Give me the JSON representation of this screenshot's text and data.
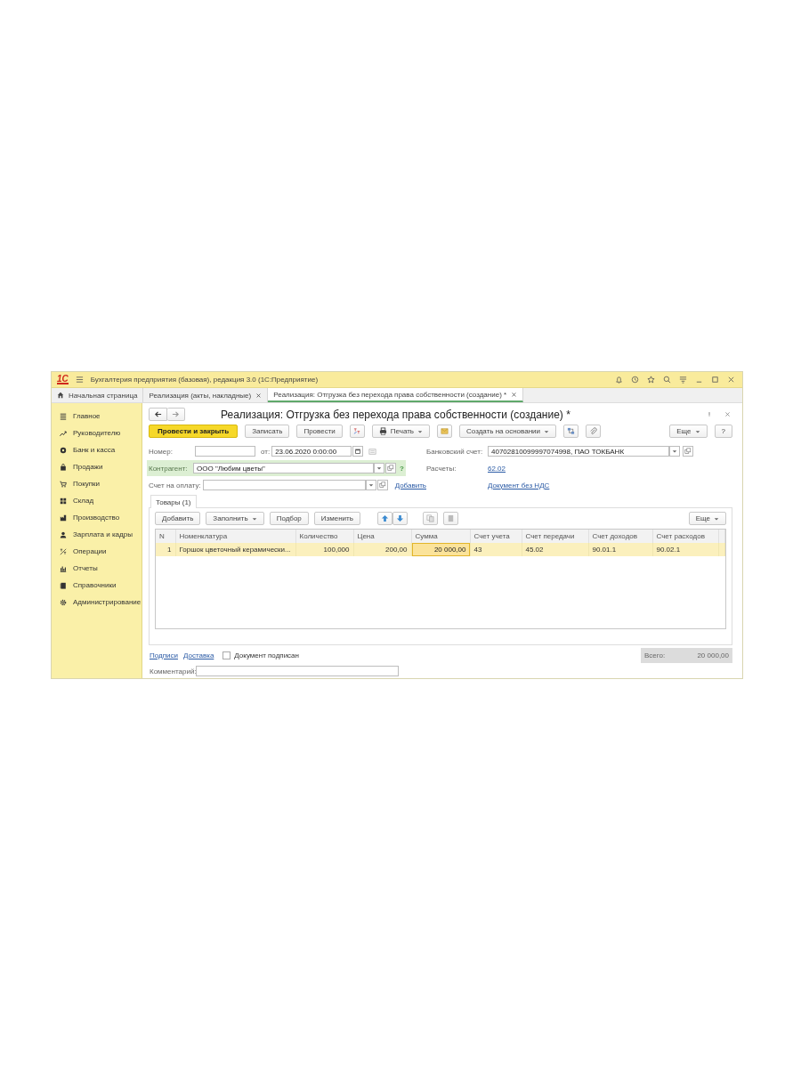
{
  "title_bar": {
    "logo": "1С",
    "title": "Бухгалтерия предприятия (базовая), редакция 3.0  (1С:Предприятие)"
  },
  "tabs": [
    {
      "label": "Начальная страница",
      "selected": false,
      "closable": false
    },
    {
      "label": "Реализация (акты, накладные)",
      "selected": false,
      "closable": true
    },
    {
      "label": "Реализация: Отгрузка без перехода права собственности (создание) *",
      "selected": true,
      "closable": true
    }
  ],
  "sidebar": {
    "items": [
      {
        "label": "Главное"
      },
      {
        "label": "Руководителю"
      },
      {
        "label": "Банк и касса"
      },
      {
        "label": "Продажи"
      },
      {
        "label": "Покупки"
      },
      {
        "label": "Склад"
      },
      {
        "label": "Производство"
      },
      {
        "label": "Зарплата и кадры"
      },
      {
        "label": "Операции"
      },
      {
        "label": "Отчеты"
      },
      {
        "label": "Справочники"
      },
      {
        "label": "Администрирование"
      }
    ]
  },
  "form": {
    "title": "Реализация: Отгрузка без перехода права собственности (создание) *",
    "toolbar": [
      {
        "kind": "primary",
        "label": "Провести и закрыть"
      },
      {
        "kind": "plain",
        "label": "Записать"
      },
      {
        "kind": "plain",
        "label": "Провести"
      },
      {
        "kind": "icon"
      },
      {
        "kind": "menu",
        "label": "Печать"
      },
      {
        "kind": "icon"
      },
      {
        "kind": "menu",
        "label": "Создать на основании"
      },
      {
        "kind": "icon"
      },
      {
        "kind": "icon"
      }
    ],
    "toolbar_right": [
      {
        "kind": "menu",
        "label": "Еще"
      },
      {
        "kind": "plain",
        "label": "?"
      }
    ],
    "number": {
      "label": "Номер:"
    },
    "date": {
      "label": "от:",
      "value": "23.06.2020  0:00:00"
    },
    "bank_account": {
      "label": "Банковский счет:",
      "value": "40702810099997074998, ПАО ТОКБАНК"
    },
    "counterparty": {
      "label": "Контрагент:",
      "value": "ООО \"Любим цветы\"",
      "hint": "?"
    },
    "settlements": {
      "label": "Расчеты:",
      "link": "62.02"
    },
    "invoice": {
      "label": "Счет на оплату:",
      "link": "Добавить"
    },
    "vat_link": "Документ без НДС",
    "section_tabs": [
      {
        "label": "Товары (1)",
        "selected": true
      }
    ],
    "table_toolbar": [
      {
        "kind": "plain",
        "label": "Добавить"
      },
      {
        "kind": "menu",
        "label": "Заполнить"
      },
      {
        "kind": "plain",
        "label": "Подбор"
      },
      {
        "kind": "plain",
        "label": "Изменить"
      },
      {
        "kind": "icon"
      },
      {
        "kind": "icon"
      },
      {
        "kind": "icon"
      },
      {
        "kind": "icon"
      }
    ],
    "table_toolbar_right": [
      {
        "kind": "menu",
        "label": "Еще"
      }
    ],
    "table": {
      "columns": [
        {
          "label": "N",
          "kind": "number"
        },
        {
          "label": "Номенклатура",
          "kind": "text"
        },
        {
          "label": "Количество",
          "kind": "number"
        },
        {
          "label": "Цена",
          "kind": "number"
        },
        {
          "label": "Сумма",
          "kind": "number"
        },
        {
          "label": "Счет учета",
          "kind": "text"
        },
        {
          "label": "Счет передачи",
          "kind": "text"
        },
        {
          "label": "Счет доходов",
          "kind": "text"
        },
        {
          "label": "Счет расходов",
          "kind": "text"
        }
      ],
      "rows": [
        {
          "selected": true,
          "cells": [
            {
              "text": "1",
              "focused": false
            },
            {
              "text": "Горшок цветочный керамически...",
              "focused": false
            },
            {
              "text": "100,000",
              "focused": false
            },
            {
              "text": "200,00",
              "focused": false
            },
            {
              "text": "20 000,00",
              "focused": true
            },
            {
              "text": "43",
              "focused": false
            },
            {
              "text": "45.02",
              "focused": false
            },
            {
              "text": "90.01.1",
              "focused": false
            },
            {
              "text": "90.02.1",
              "focused": false
            }
          ]
        }
      ]
    },
    "footer": {
      "links": [
        "Подписи",
        "Доставка"
      ],
      "signed": {
        "label": "Документ подписан",
        "checked": false
      },
      "total_label": "Всего:",
      "total": "20 000,00"
    },
    "comment": {
      "label": "Комментарий:"
    }
  }
}
